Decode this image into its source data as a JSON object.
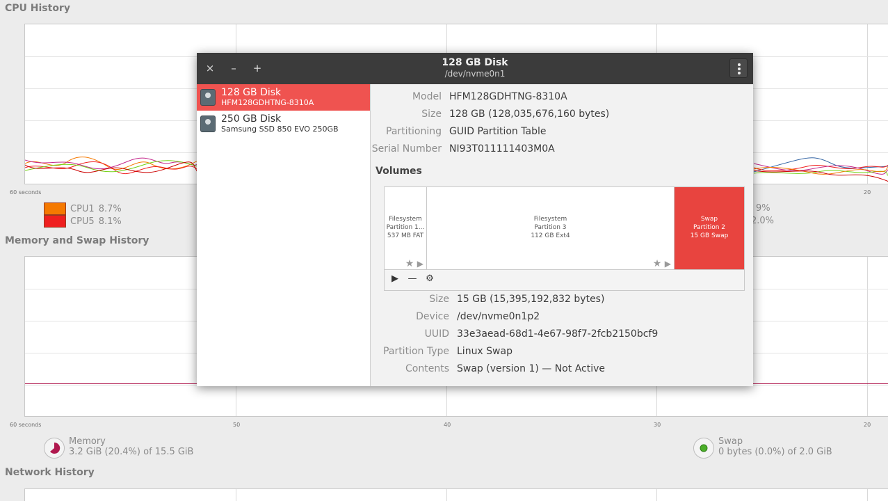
{
  "monitor": {
    "cpu_title": "CPU History",
    "mem_title": "Memory and Swap History",
    "net_title": "Network History",
    "axis": {
      "left": "60 seconds",
      "t50": "50",
      "t40": "40",
      "t30": "30",
      "t20": "20"
    },
    "cpu_legend": [
      {
        "name": "CPU1",
        "value": "8.7%",
        "color": "#f57900"
      },
      {
        "name": "CPU5",
        "value": "8.1%",
        "color": "#ef1f1f"
      }
    ],
    "cpu_legend_right": {
      "v1": "9%",
      "v2": "2.0%"
    },
    "memory": {
      "label": "Memory",
      "value": "3.2 GiB (20.4%) of 15.5 GiB",
      "color": "#b0184e"
    },
    "swap": {
      "label": "Swap",
      "value": "0 bytes (0.0%) of 2.0 GiB",
      "color": "#4caf2a"
    }
  },
  "dialog": {
    "title": "128 GB Disk",
    "subtitle": "/dev/nvme0n1",
    "close_icon": "×",
    "minimize_icon": "–",
    "maximize_icon": "+",
    "disks": [
      {
        "name": "128 GB Disk",
        "model": "HFM128GDHTNG-8310A"
      },
      {
        "name": "250 GB Disk",
        "model": "Samsung SSD 850 EVO 250GB"
      }
    ],
    "disk_info": {
      "model_k": "Model",
      "model_v": "HFM128GDHTNG-8310A",
      "size_k": "Size",
      "size_v": "128 GB (128,035,676,160 bytes)",
      "part_k": "Partitioning",
      "part_v": "GUID Partition Table",
      "serial_k": "Serial Number",
      "serial_v": "NI93T011111403M0A"
    },
    "volumes_title": "Volumes",
    "partitions": [
      {
        "l1": "Filesystem",
        "l2": "Partition 1...",
        "l3": "537 MB FAT"
      },
      {
        "l1": "Filesystem",
        "l2": "Partition 3",
        "l3": "112 GB Ext4"
      },
      {
        "l1": "Swap",
        "l2": "Partition 2",
        "l3": "15 GB Swap"
      }
    ],
    "vol_info": {
      "size_k": "Size",
      "size_v": "15 GB (15,395,192,832 bytes)",
      "device_k": "Device",
      "device_v": "/dev/nvme0n1p2",
      "uuid_k": "UUID",
      "uuid_v": "33e3aead-68d1-4e67-98f7-2fcb2150bcf9",
      "ptype_k": "Partition Type",
      "ptype_v": "Linux Swap",
      "contents_k": "Contents",
      "contents_v": "Swap (version 1) — Not Active"
    }
  }
}
